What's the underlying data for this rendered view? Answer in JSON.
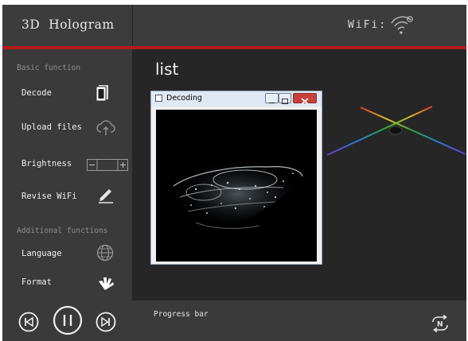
{
  "header": {
    "app_title": "3D  Hologram",
    "wifi_label": "WiFi:",
    "wifi_icon": "wifi-icon"
  },
  "sidebar": {
    "basic_section_label": "Basic function",
    "additional_section_label": "Additional functions",
    "items": [
      {
        "label": "Decode",
        "icon": "document-icon"
      },
      {
        "label": "Upload files",
        "icon": "cloud-upload-icon"
      },
      {
        "label": "Brightness",
        "icon": "brightness-stepper"
      },
      {
        "label": "Revise WiFi",
        "icon": "pencil-icon"
      },
      {
        "label": "Language",
        "icon": "globe-icon"
      },
      {
        "label": "Format",
        "icon": "format-brush-icon"
      }
    ]
  },
  "main": {
    "list_title": "list",
    "decoding_window": {
      "title": "Decoding"
    }
  },
  "footer": {
    "progress_label": "Progress bar",
    "loop_icon": "loop-n-icon"
  },
  "playback": {
    "icons": [
      "previous-icon",
      "pause-icon",
      "next-icon"
    ]
  },
  "colors": {
    "accent_red": "#b5191a",
    "sidebar_bg": "#3a3a3a",
    "content_bg": "#262626"
  }
}
